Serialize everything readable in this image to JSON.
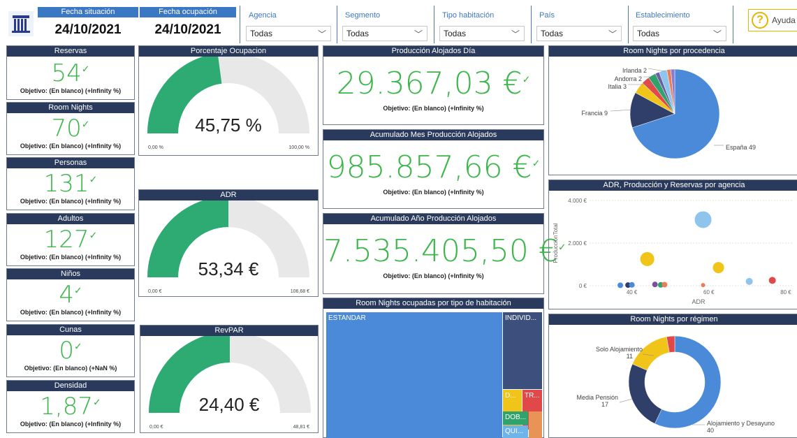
{
  "header": {
    "fecha_situacion_label": "Fecha situación",
    "fecha_situacion_value": "24/10/2021",
    "fecha_ocupacion_label": "Fecha ocupación",
    "fecha_ocupacion_value": "24/10/2021",
    "help_label": "Ayuda",
    "filters": [
      {
        "label": "Agencia",
        "value": "Todas"
      },
      {
        "label": "Segmento",
        "value": "Todas"
      },
      {
        "label": "Tipo habitación",
        "value": "Todas"
      },
      {
        "label": "País",
        "value": "Todas"
      },
      {
        "label": "Establecimiento",
        "value": "Todas"
      }
    ]
  },
  "kpis": [
    {
      "title": "Reservas",
      "value": "54",
      "subtitle": "Objetivo: (En blanco) (+Infinity %)"
    },
    {
      "title": "Room Nights",
      "value": "70",
      "subtitle": "Objetivo: (En blanco) (+Infinity %)"
    },
    {
      "title": "Personas",
      "value": "131",
      "subtitle": "Objetivo: (En blanco) (+Infinity %)"
    },
    {
      "title": "Adultos",
      "value": "127",
      "subtitle": "Objetivo: (En blanco) (+Infinity %)"
    },
    {
      "title": "Niños",
      "value": "4",
      "subtitle": "Objetivo: (En blanco) (+Infinity %)"
    },
    {
      "title": "Cunas",
      "value": "0",
      "subtitle": "Objetivo: (En blanco) (+NaN %)"
    },
    {
      "title": "Densidad",
      "value": "1,87",
      "subtitle": "Objetivo: (En blanco) (+Infinity %)"
    }
  ],
  "gauges": [
    {
      "title": "Porcentaje Ocupacion",
      "value": "45,75 %",
      "min": "0,00 %",
      "max": "100,00 %",
      "fraction": 0.4575
    },
    {
      "title": "ADR",
      "value": "53,34 €",
      "min": "0,00 €",
      "max": "106,68 €",
      "fraction": 0.5
    },
    {
      "title": "RevPAR",
      "value": "24,40 €",
      "min": "0,00 €",
      "max": "48,81 €",
      "fraction": 0.5
    }
  ],
  "big_kpis": [
    {
      "title": "Producción Alojados Día",
      "value": "29.367,03 €",
      "subtitle": "Objetivo: (En blanco) (+Infinity %)"
    },
    {
      "title": "Acumulado Mes Producción Alojados",
      "value": "985.857,66 €",
      "subtitle": "Objetivo: (En blanco) (+Infinity %)"
    },
    {
      "title": "Acumulado Año Producción Alojados",
      "value": "7.535.405,50 €",
      "subtitle": "Objetivo: (En blanco) (+Infinity %)"
    }
  ],
  "treemap": {
    "title": "Room Nights ocupadas por tipo de habitación",
    "labels": {
      "estandar": "ESTANDAR",
      "individual": "INDIVID...",
      "d": "D...",
      "tr": "TR...",
      "dob": "DOB...",
      "qui": "QUI..."
    }
  },
  "charts": {
    "pie_title": "Room Nights por procedencia",
    "scatter_title": "ADR, Producción y Reservas por agencia",
    "donut_title": "Room Nights por régimen"
  },
  "chart_data": [
    {
      "type": "pie",
      "title": "Room Nights por procedencia",
      "slices": [
        {
          "label": "España",
          "value": 49,
          "color": "#4a8ad8"
        },
        {
          "label": "Francia",
          "value": 9,
          "color": "#2f3f6a"
        },
        {
          "label": "Italia",
          "value": 3,
          "color": "#f0c419"
        },
        {
          "label": "",
          "value": 2,
          "color": "#e0484a"
        },
        {
          "label": "Andorra",
          "value": 2,
          "color": "#2fa36b"
        },
        {
          "label": "",
          "value": 1,
          "color": "#6b5ea8"
        },
        {
          "label": "Irlanda",
          "value": 2,
          "color": "#8fc4ec"
        },
        {
          "label": "",
          "value": 1,
          "color": "#e87f5a"
        },
        {
          "label": "",
          "value": 1,
          "color": "#8a7dd0"
        }
      ],
      "shown_labels": [
        "Irlanda 2",
        "Andorra 2",
        "Italia 3",
        "Francia 9",
        "España 49"
      ]
    },
    {
      "type": "scatter",
      "title": "ADR, Producción y Reservas por agencia",
      "xlabel": "ADR",
      "ylabel": "ProduccionTotal",
      "xticks": [
        "40 €",
        "60 €",
        "80 €"
      ],
      "yticks": [
        "0 €",
        "2.000 €",
        "4.000 €"
      ],
      "xlim": [
        29,
        82
      ],
      "ylim": [
        0,
        4000
      ],
      "points": [
        {
          "x": 37,
          "y": 20,
          "r": 4,
          "color": "#4a8ad8"
        },
        {
          "x": 39,
          "y": 30,
          "r": 4,
          "color": "#2f3f6a"
        },
        {
          "x": 40,
          "y": 40,
          "r": 4,
          "color": "#4a8ad8"
        },
        {
          "x": 44,
          "y": 1250,
          "r": 10,
          "color": "#f0c419"
        },
        {
          "x": 46,
          "y": 60,
          "r": 4,
          "color": "#7a4fa0"
        },
        {
          "x": 47.5,
          "y": 40,
          "r": 4,
          "color": "#2fa36b"
        },
        {
          "x": 48.5,
          "y": 50,
          "r": 4,
          "color": "#e87f5a"
        },
        {
          "x": 58.5,
          "y": 3100,
          "r": 12,
          "color": "#8fc4ec"
        },
        {
          "x": 58.5,
          "y": 30,
          "r": 3,
          "color": "#e87f5a"
        },
        {
          "x": 62.5,
          "y": 850,
          "r": 8,
          "color": "#f0c419"
        },
        {
          "x": 70.5,
          "y": 200,
          "r": 5,
          "color": "#8fc4ec"
        },
        {
          "x": 76.5,
          "y": 250,
          "r": 5,
          "color": "#e0484a"
        }
      ]
    },
    {
      "type": "pie",
      "title": "Room Nights por régimen",
      "slices": [
        {
          "label": "Alojamiento y Desayuno",
          "value": 40,
          "color": "#4a8ad8"
        },
        {
          "label": "Media Pensión",
          "value": 17,
          "color": "#2f3f6a"
        },
        {
          "label": "Solo Alojamiento",
          "value": 11,
          "color": "#f0c419"
        },
        {
          "label": "",
          "value": 2,
          "color": "#e0484a"
        }
      ],
      "shown_labels": [
        [
          "Solo Alojamiento",
          "11"
        ],
        [
          "Media Pensión",
          "17"
        ],
        [
          "Alojamiento y Desayuno",
          "40"
        ]
      ]
    }
  ]
}
